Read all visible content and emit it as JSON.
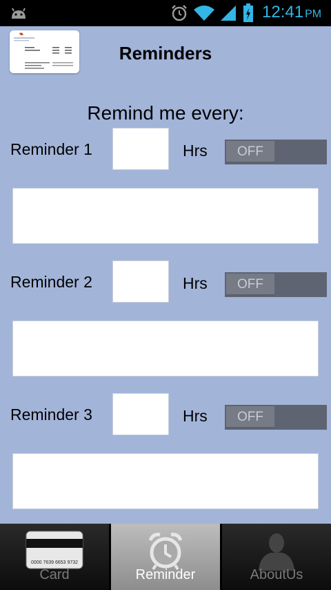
{
  "status_bar": {
    "time": "12:41",
    "ampm": "PM"
  },
  "header": {
    "title": "Reminders"
  },
  "subtitle": "Remind me every:",
  "reminders": [
    {
      "label": "Reminder 1",
      "hours_value": "",
      "unit": "Hrs",
      "toggle": "OFF",
      "note": ""
    },
    {
      "label": "Reminder 2",
      "hours_value": "",
      "unit": "Hrs",
      "toggle": "OFF",
      "note": ""
    },
    {
      "label": "Reminder 3",
      "hours_value": "",
      "unit": "Hrs",
      "toggle": "OFF",
      "note": ""
    }
  ],
  "tabs": [
    {
      "label": "Card",
      "icon": "credit-card-icon"
    },
    {
      "label": "Reminder",
      "icon": "alarm-clock-icon",
      "active": true
    },
    {
      "label": "AboutUs",
      "icon": "person-icon"
    }
  ],
  "card_thumbnail": {
    "number": "0000 7639 6653 9732"
  },
  "colors": {
    "background": "#a3b4d9",
    "status_accent": "#33b5e5",
    "toggle_off": "#5e6472"
  }
}
